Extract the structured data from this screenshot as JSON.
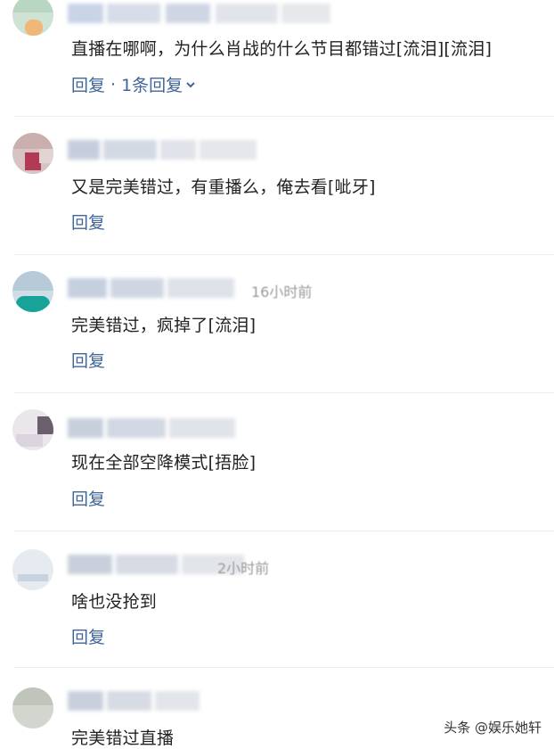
{
  "comments": [
    {
      "content": "直播在哪啊，为什么肖战的什么节目都错过[流泪][流泪]",
      "reply_label": "回复",
      "separator": "·",
      "reply_count": "1条回复"
    },
    {
      "content": "又是完美错过，有重播么，俺去看[呲牙]",
      "reply_label": "回复"
    },
    {
      "partial_meta": "16小时前",
      "content": "完美错过，疯掉了[流泪]",
      "reply_label": "回复"
    },
    {
      "content": "现在全部空降模式[捂脸]",
      "reply_label": "回复"
    },
    {
      "partial_meta": "2小时前",
      "content": "啥也没抢到",
      "reply_label": "回复"
    },
    {
      "content": "完美错过直播"
    }
  ],
  "watermark": "头条 @娱乐她轩",
  "colors": {
    "link": "#406599",
    "text": "#222222",
    "divider": "#eeeeee"
  }
}
